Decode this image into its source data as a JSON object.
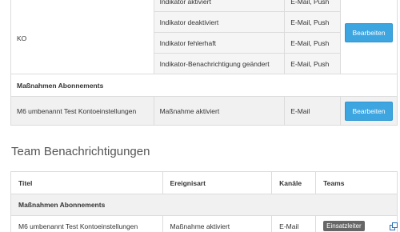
{
  "user_table": {
    "group_label": "KO",
    "rows": [
      {
        "event": "Indikator aktiviert",
        "channels": "E-Mail, Push"
      },
      {
        "event": "Indikator deaktiviert",
        "channels": "E-Mail, Push"
      },
      {
        "event": "Indikator fehlerhaft",
        "channels": "E-Mail, Push"
      },
      {
        "event": "Indikator-Benachrichtigung geändert",
        "channels": "E-Mail, Push"
      }
    ],
    "edit_label": "Bearbeiten",
    "section_title": "Maßnahmen Abonnements",
    "measure_row": {
      "title": "M6 umbenannt Test Kontoeinstellungen",
      "event": "Maßnahme aktiviert",
      "channels": "E-Mail",
      "edit_label": "Bearbeiten"
    }
  },
  "team_section": {
    "heading": "Team Benachrichtigungen",
    "columns": [
      "Titel",
      "Ereignisart",
      "Kanäle",
      "Teams"
    ],
    "group_title": "Maßnahmen Abonnements",
    "row": {
      "title": "M6 umbenannt Test Kontoeinstellungen",
      "event": "Maßnahme aktiviert",
      "channels": "E-Mail",
      "team": "Einsatzleiter"
    }
  },
  "colors": {
    "button": "#3da5e0",
    "badge": "#666666",
    "corner_icon": "#2a6fb3"
  }
}
